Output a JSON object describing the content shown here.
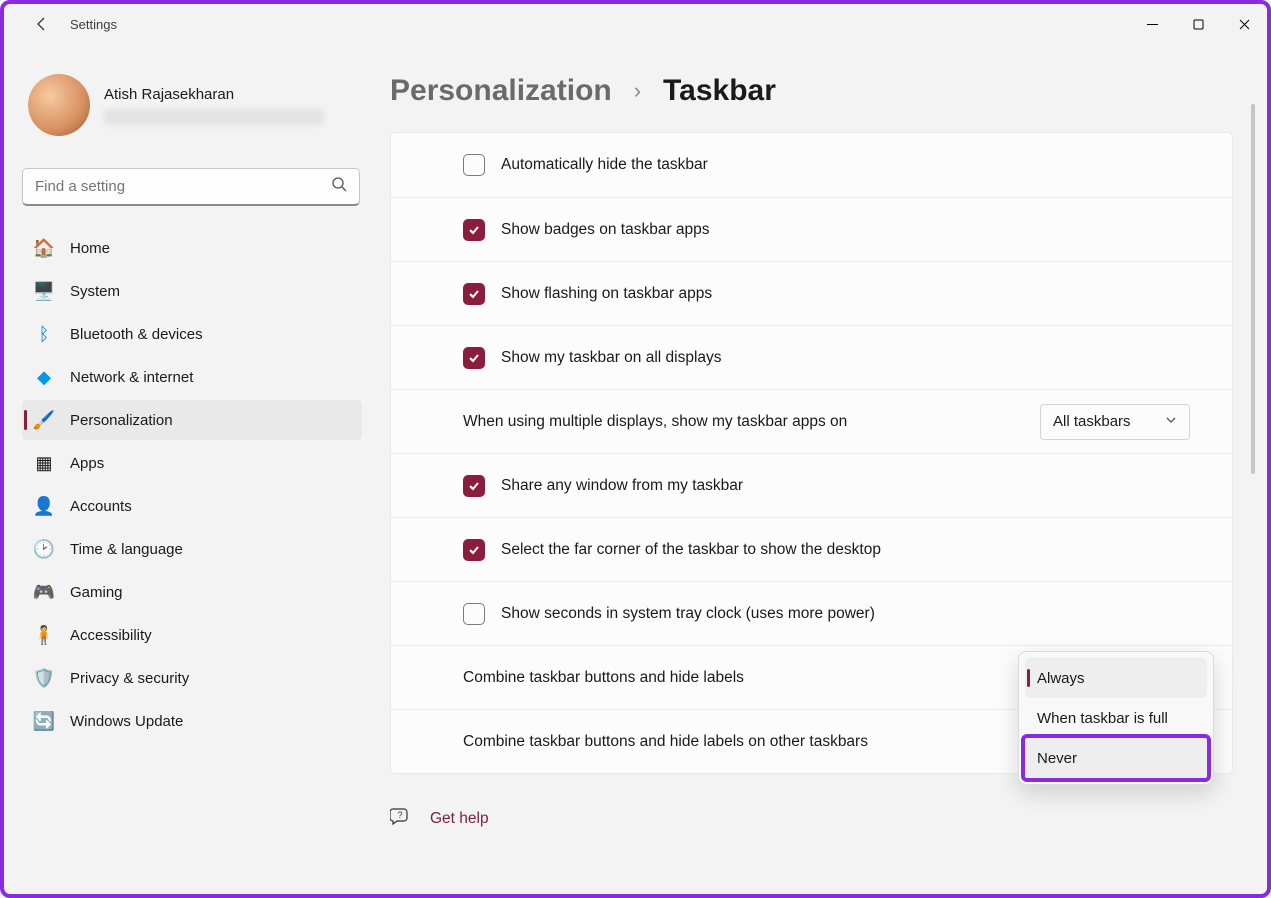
{
  "titlebar": {
    "app_name": "Settings"
  },
  "user": {
    "name": "Atish Rajasekharan"
  },
  "search": {
    "placeholder": "Find a setting"
  },
  "nav": {
    "items": [
      {
        "label": "Home"
      },
      {
        "label": "System"
      },
      {
        "label": "Bluetooth & devices"
      },
      {
        "label": "Network & internet"
      },
      {
        "label": "Personalization"
      },
      {
        "label": "Apps"
      },
      {
        "label": "Accounts"
      },
      {
        "label": "Time & language"
      },
      {
        "label": "Gaming"
      },
      {
        "label": "Accessibility"
      },
      {
        "label": "Privacy & security"
      },
      {
        "label": "Windows Update"
      }
    ]
  },
  "breadcrumb": {
    "parent": "Personalization",
    "current": "Taskbar"
  },
  "rows": {
    "auto_hide": "Automatically hide the taskbar",
    "badges": "Show badges on taskbar apps",
    "flashing": "Show flashing on taskbar apps",
    "all_displays": "Show my taskbar on all displays",
    "multi_display_label": "When using multiple displays, show my taskbar apps on",
    "multi_display_value": "All taskbars",
    "share_window": "Share any window from my taskbar",
    "far_corner": "Select the far corner of the taskbar to show the desktop",
    "show_seconds": "Show seconds in system tray clock (uses more power)",
    "combine_1": "Combine taskbar buttons and hide labels",
    "combine_2": "Combine taskbar buttons and hide labels on other taskbars"
  },
  "dropdown": {
    "opt1": "Always",
    "opt2": "When taskbar is full",
    "opt3": "Never"
  },
  "help": {
    "label": "Get help"
  }
}
